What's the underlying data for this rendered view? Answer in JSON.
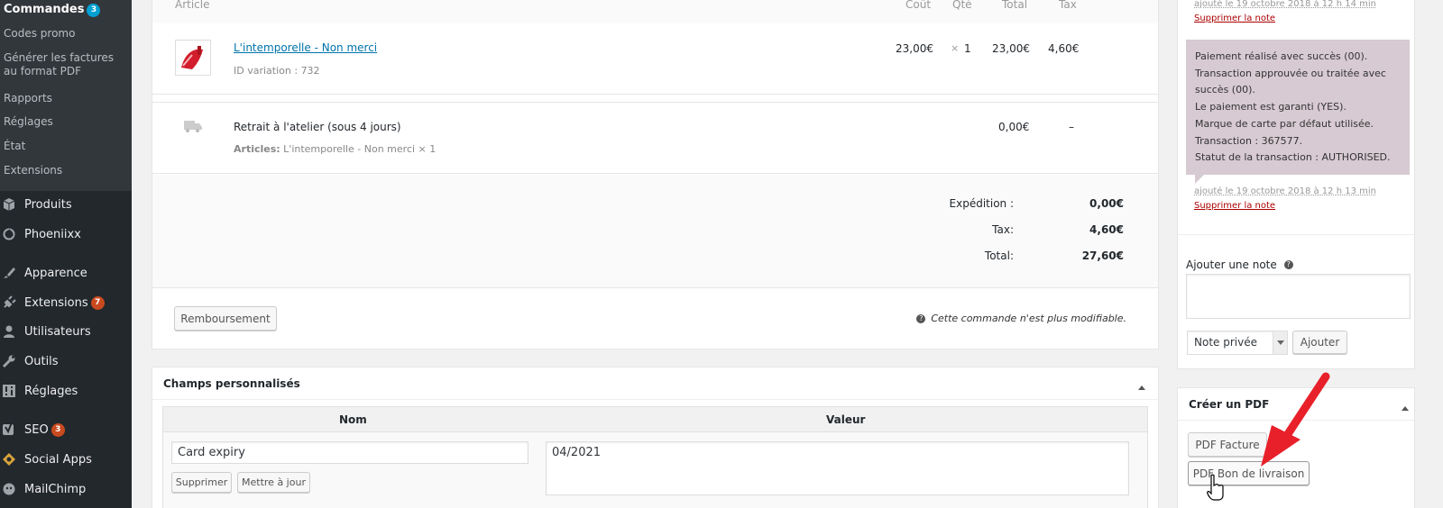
{
  "sidebar": {
    "submenu": [
      {
        "label": "Commandes",
        "badge": "3",
        "current": true
      },
      {
        "label": "Codes promo"
      },
      {
        "label": "Générer les factures au format PDF"
      },
      {
        "label": "Rapports"
      },
      {
        "label": "Réglages"
      },
      {
        "label": "État"
      },
      {
        "label": "Extensions"
      }
    ],
    "menu": [
      {
        "label": "Produits",
        "icon": "cube-icon"
      },
      {
        "label": "Phoeniixx",
        "icon": "phoenix-icon"
      },
      {
        "label": "Apparence",
        "icon": "brush-icon"
      },
      {
        "label": "Extensions",
        "icon": "plugin-icon",
        "badge": "7"
      },
      {
        "label": "Utilisateurs",
        "icon": "user-icon"
      },
      {
        "label": "Outils",
        "icon": "wrench-icon"
      },
      {
        "label": "Réglages",
        "icon": "settings-icon"
      },
      {
        "label": "SEO",
        "icon": "yoast-icon",
        "badge": "3"
      },
      {
        "label": "Social Apps",
        "icon": "social-icon"
      },
      {
        "label": "MailChimp",
        "icon": "mailchimp-icon"
      }
    ]
  },
  "items_table": {
    "headers": {
      "article": "Article",
      "cout": "Coût",
      "qte": "Qté",
      "total": "Total",
      "tax": "Tax"
    },
    "product": {
      "name": "L'intemporelle - Non merci",
      "variation_label": "ID variation :",
      "variation_id": "732",
      "cost": "23,00€",
      "qty_sign": "×",
      "qty": "1",
      "total": "23,00€",
      "tax": "4,60€"
    },
    "shipping": {
      "name": "Retrait à l'atelier (sous 4 jours)",
      "articles_label": "Articles:",
      "articles_value": "L'intemporelle - Non merci × 1",
      "total": "0,00€",
      "tax": "–"
    },
    "totals": [
      {
        "label": "Expédition :",
        "value": "0,00€"
      },
      {
        "label": "Tax:",
        "value": "4,60€"
      },
      {
        "label": "Total:",
        "value": "27,60€"
      }
    ],
    "refund_button": "Remboursement",
    "not_editable": "Cette commande n'est plus modifiable."
  },
  "custom_fields": {
    "title": "Champs personnalisés",
    "col_name": "Nom",
    "col_value": "Valeur",
    "row": {
      "name": "Card expiry",
      "value": "04/2021"
    },
    "delete_button": "Supprimer",
    "update_button": "Mettre à jour"
  },
  "notes": {
    "meta_top": "ajouté le 19 octobre 2018 à 12 h 14 min",
    "delete_top": "Supprimer la note",
    "note_lines": [
      "Paiement réalisé avec succès (00).",
      "Transaction approuvée ou traitée avec succès (00).",
      "Le paiement est garanti (YES).",
      "Marque de carte par défaut utilisée.",
      "Transaction : 367577.",
      "Statut de la transaction : AUTHORISED."
    ],
    "meta": "ajouté le 19 octobre 2018 à 12 h 13 min",
    "delete": "Supprimer la note",
    "add_label": "Ajouter une note",
    "note_type": "Note privée",
    "add_button": "Ajouter"
  },
  "pdf_box": {
    "title": "Créer un PDF",
    "invoice_button": "PDF Facture",
    "delivery_button": "PDF Bon de livraison"
  },
  "colors": {
    "note_bg": "#d7cad2",
    "annotation_arrow": "#e8202a",
    "link": "#0073aa",
    "delete_link": "#a00"
  }
}
